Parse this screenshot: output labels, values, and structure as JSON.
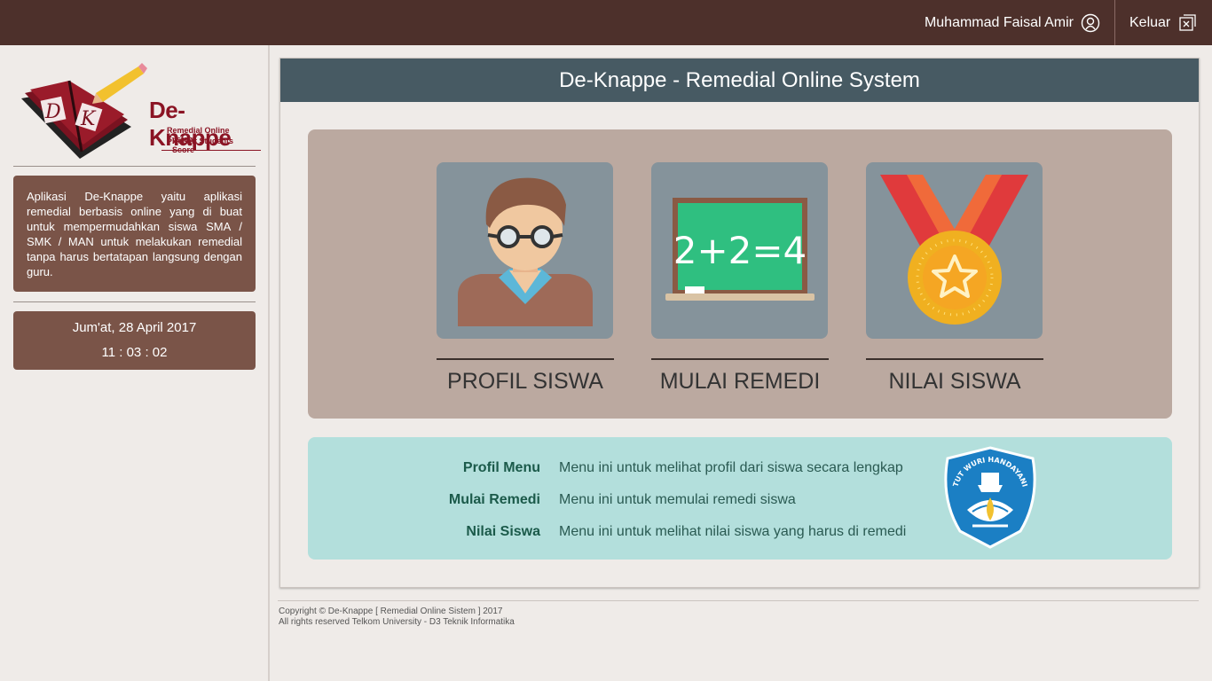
{
  "header": {
    "user_name": "Muhammad Faisal Amir",
    "logout_label": "Keluar"
  },
  "sidebar": {
    "logo": {
      "title": "De-Knappe",
      "subtitle1": "Remedial Online System",
      "subtitle2": "Repair Students Score"
    },
    "description": "Aplikasi De-Knappe yaitu aplikasi remedial berbasis online yang di buat untuk mempermudahkan siswa SMA / SMK / MAN untuk melakukan remedial tanpa harus bertatapan langsung dengan guru.",
    "date": "Jum'at, 28 April 2017",
    "time": "11 : 03 : 02"
  },
  "main": {
    "title": "De-Knappe - Remedial Online System",
    "menu": [
      {
        "label": "PROFIL SISWA",
        "icon": "student-avatar-icon"
      },
      {
        "label": "MULAI REMEDI",
        "icon": "chalkboard-icon"
      },
      {
        "label": "NILAI SISWA",
        "icon": "medal-icon"
      }
    ],
    "info": [
      {
        "key": "Profil Menu",
        "value": "Menu ini untuk melihat profil dari siswa secara lengkap"
      },
      {
        "key": "Mulai Remedi",
        "value": "Menu ini untuk memulai remedi siswa"
      },
      {
        "key": "Nilai Siswa",
        "value": "Menu ini untuk melihat nilai siswa yang harus di remedi"
      }
    ],
    "emblem_text": "TUT WURI HANDAYANI",
    "chalkboard_text": "2+2=4"
  },
  "footer": {
    "line1": "Copyright © De-Knappe [ Remedial Online Sistem ] 2017",
    "line2": "All rights reserved Telkom University - D3 Teknik Informatika"
  },
  "colors": {
    "topbar": "#4d302b",
    "panel_header": "#475a63",
    "sidebar_box": "#7a5448",
    "menu_area": "#bba9a0",
    "info_area": "#b3dfdc"
  }
}
